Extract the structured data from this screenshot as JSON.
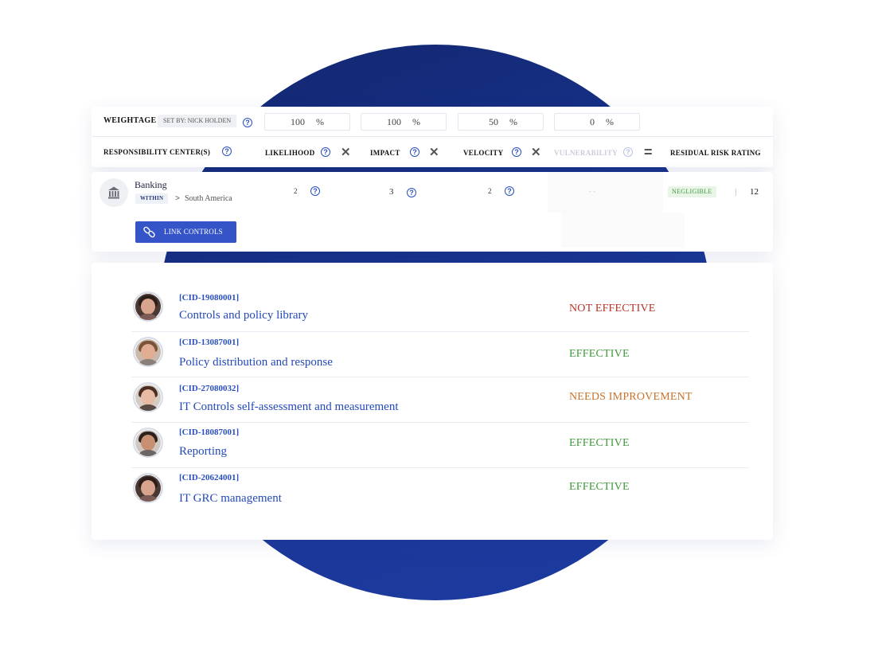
{
  "weightage": {
    "label": "WEIGHTAGE",
    "set_by": "SET BY:  NICK HOLDEN",
    "values": [
      "100",
      "100",
      "50",
      "0"
    ],
    "unit": "%"
  },
  "columns": {
    "responsibility": "RESPONSIBILITY CENTER(S)",
    "likelihood": "LIKELIHOOD",
    "impact": "IMPACT",
    "velocity": "VELOCITY",
    "vulnerability": "VULNERABILITY",
    "residual": "RESIDUAL RISK RATING",
    "times": "✕",
    "equals": "="
  },
  "risk_row": {
    "name": "Banking",
    "within": "WITHIN",
    "region": "South America",
    "likelihood": "2",
    "impact": "3",
    "velocity": "2",
    "vulnerability": "- -",
    "rating_label": "NEGLIGIBLE",
    "rating_value": "12",
    "link_button": "LINK CONTROLS"
  },
  "controls": [
    {
      "id": "[CID-19080001]",
      "name": "Controls and policy library",
      "status": "NOT EFFECTIVE",
      "status_color": "#b8332a"
    },
    {
      "id": "[CID-13087001]",
      "name": "Policy distribution and response",
      "status": "EFFECTIVE",
      "status_color": "#3e9a3a"
    },
    {
      "id": "[CID-27080032]",
      "name": "IT Controls self-assessment and measurement",
      "status": "NEEDS IMPROVEMENT",
      "status_color": "#c9722a"
    },
    {
      "id": "[CID-18087001]",
      "name": "Reporting",
      "status": "EFFECTIVE",
      "status_color": "#3e9a3a"
    },
    {
      "id": "[CID-20624001]",
      "name": "IT GRC management",
      "status": "EFFECTIVE",
      "status_color": "#3e9a3a"
    }
  ],
  "colors": {
    "accent": "#2a4fc0",
    "button": "#3454c8",
    "circle": "#1a3796",
    "negligible_bg": "#e9f5e6",
    "negligible_text": "#3e9a3a"
  }
}
